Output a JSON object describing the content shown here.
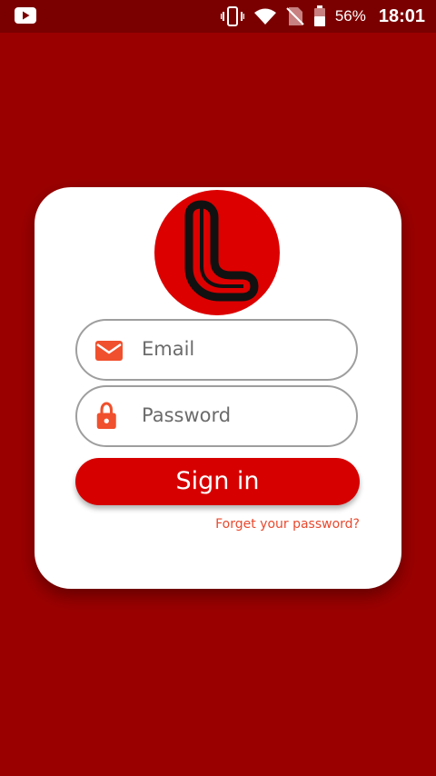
{
  "status_bar": {
    "battery_percent": "56%",
    "time": "18:01",
    "icons": [
      "youtube-icon",
      "vibrate-icon",
      "wifi-icon",
      "no-sim-icon",
      "battery-icon"
    ]
  },
  "login": {
    "email_placeholder": "Email",
    "password_placeholder": "Password",
    "sign_in_label": "Sign in",
    "forgot_password_label": "Forget your password?"
  },
  "colors": {
    "background": "#9b0000",
    "status_bar": "#7a0000",
    "accent": "#d60000",
    "icon_orange": "#f0502d",
    "link": "#e8492e"
  }
}
